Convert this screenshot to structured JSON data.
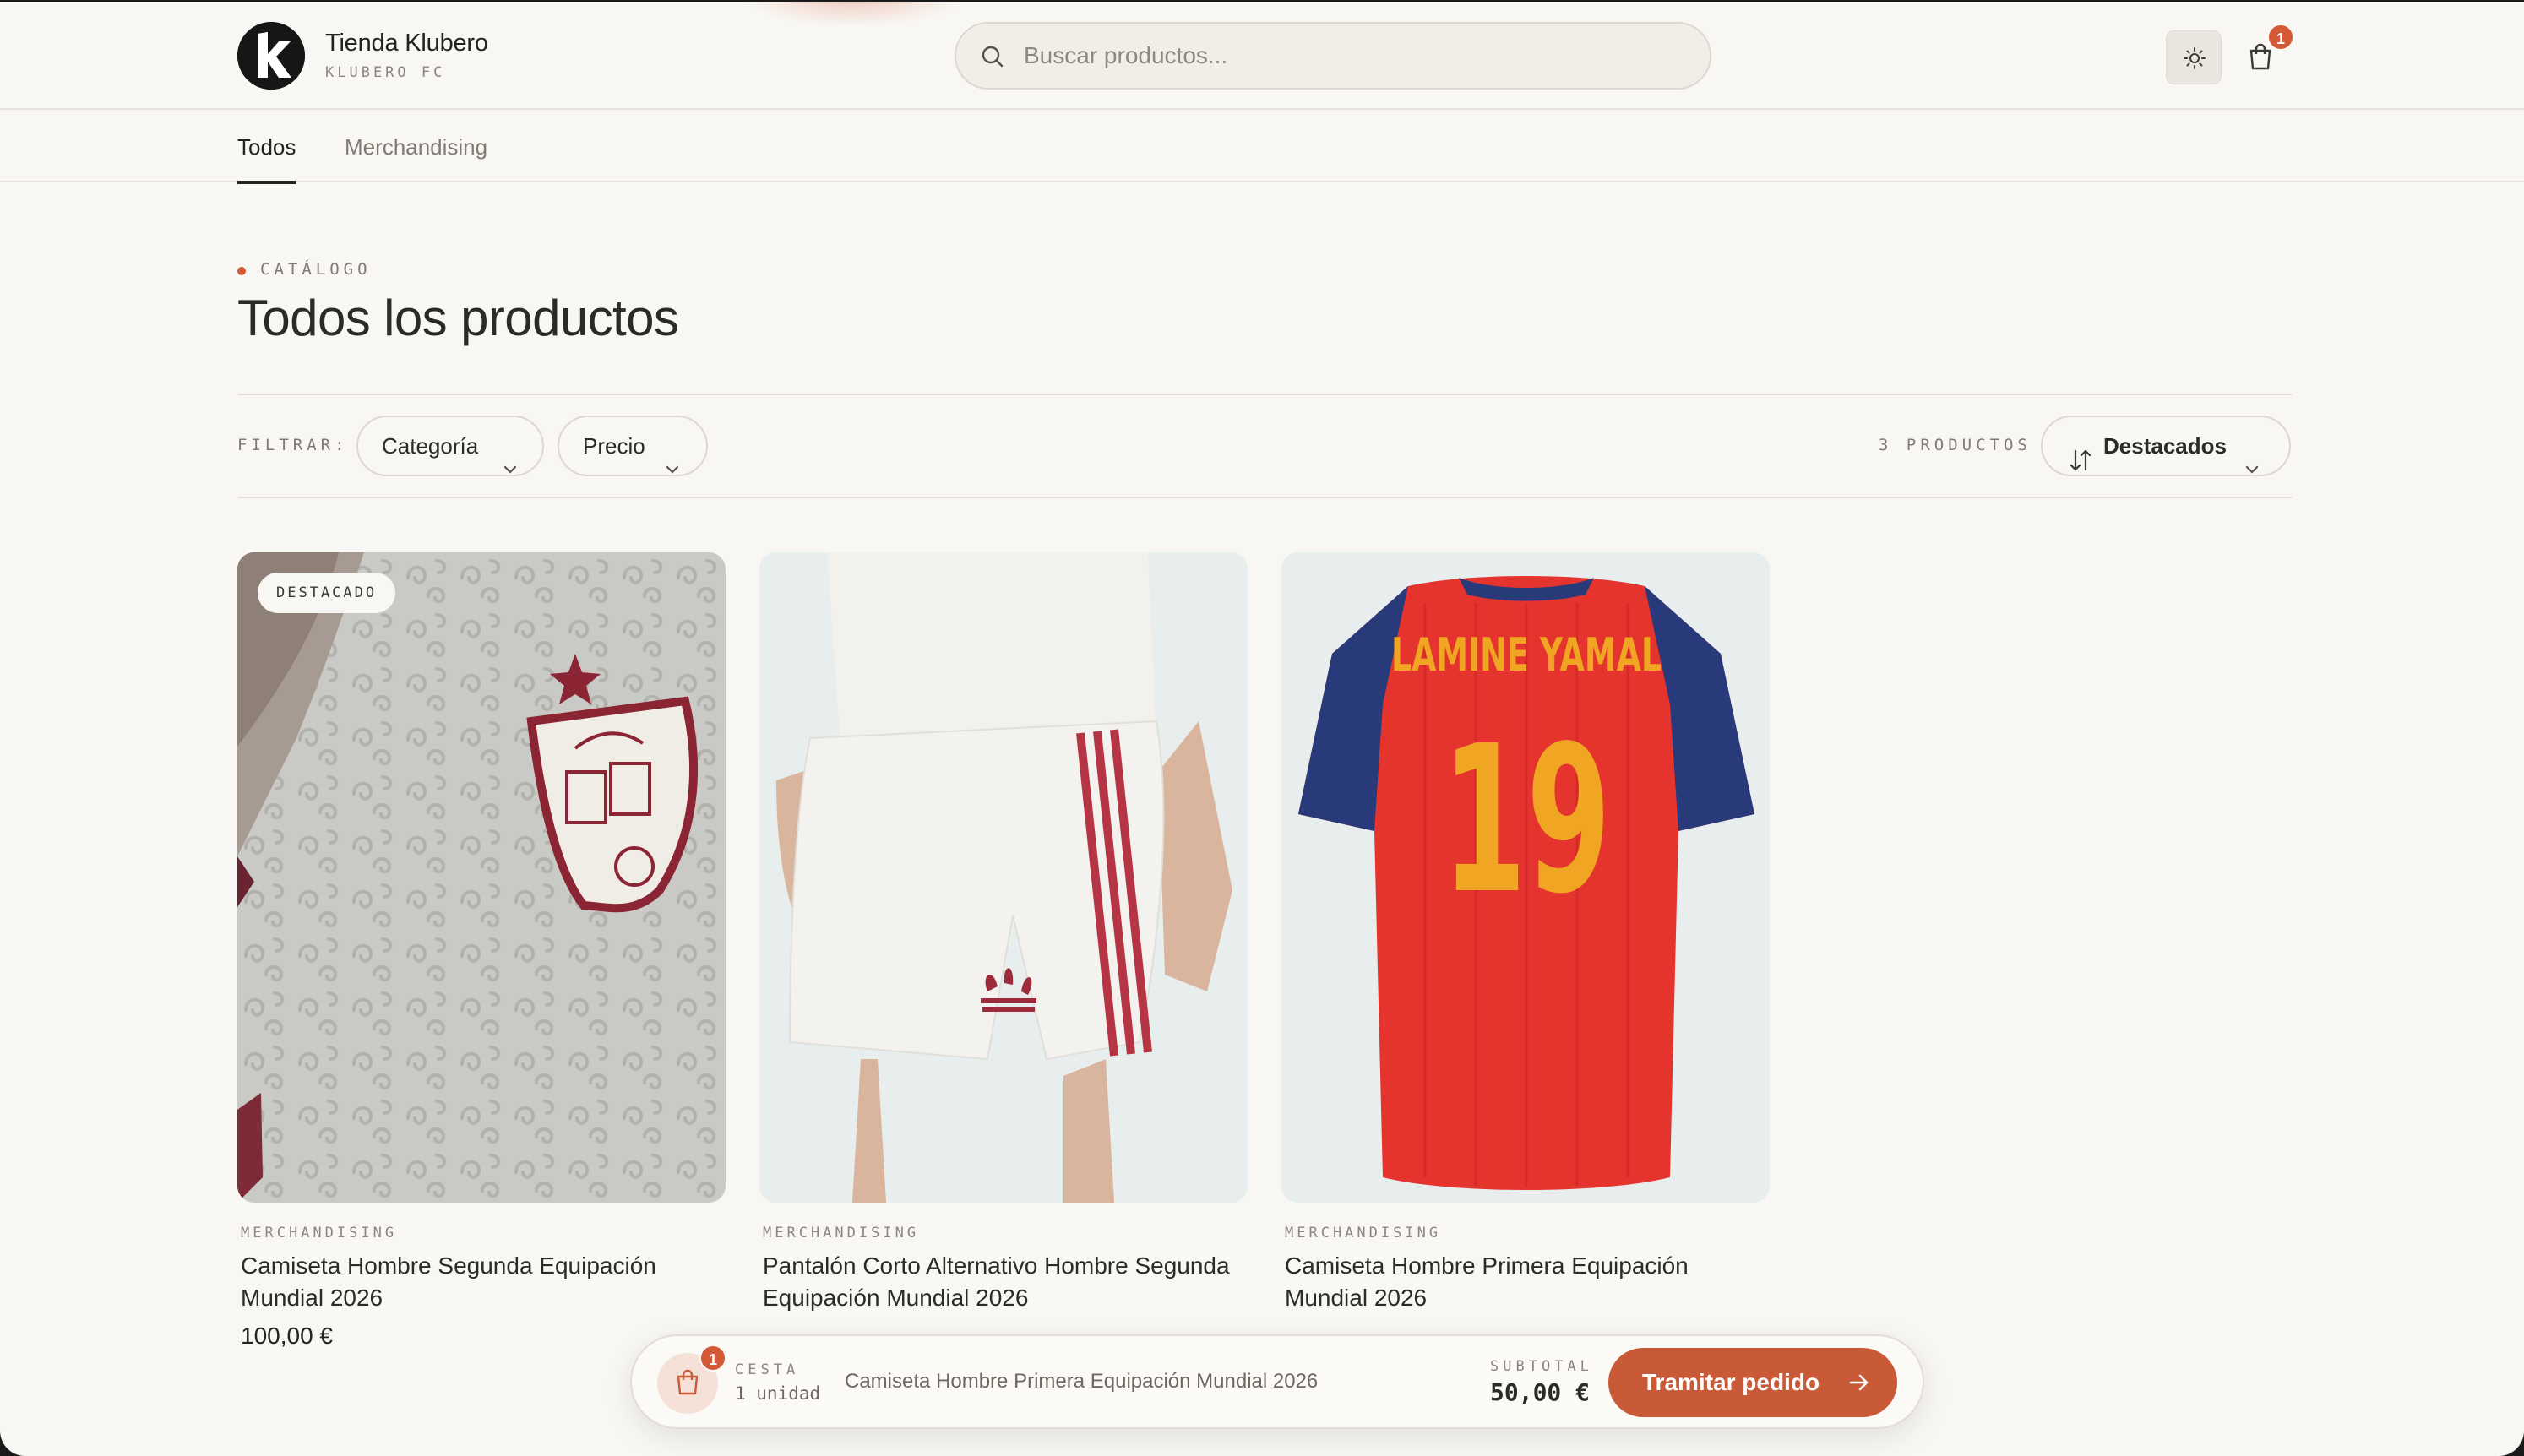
{
  "header": {
    "brand_name": "Tienda Klubero",
    "brand_sub": "KLUBERO FC",
    "search_placeholder": "Buscar productos...",
    "cart_count": "1"
  },
  "tabs": [
    {
      "label": "Todos",
      "active": true
    },
    {
      "label": "Merchandising",
      "active": false
    }
  ],
  "catalog": {
    "eyebrow": "CATÁLOGO",
    "title": "Todos los productos"
  },
  "filters": {
    "label": "FILTRAR:",
    "category": "Categoría",
    "price": "Precio",
    "count": "3 PRODUCTOS",
    "sort": "Destacados"
  },
  "products": [
    {
      "badge": "DESTACADO",
      "category": "MERCHANDISING",
      "name": "Camiseta Hombre Segunda Equipación Mundial 2026",
      "price": "100,00 €"
    },
    {
      "category": "MERCHANDISING",
      "name": "Pantalón Corto Alternativo Hombre Segunda Equipación Mundial 2026",
      "price": ""
    },
    {
      "category": "MERCHANDISING",
      "name": "Camiseta Hombre Primera Equipación Mundial 2026",
      "price": "",
      "jersey_name": "LAMINE YAMAL",
      "jersey_number": "19"
    }
  ],
  "cart_bar": {
    "count": "1",
    "label": "CESTA",
    "units": "1 unidad",
    "item": "Camiseta Hombre Primera Equipación Mundial 2026",
    "subtotal_label": "SUBTOTAL",
    "subtotal_value": "50,00 €",
    "checkout_label": "Tramitar pedido"
  },
  "colors": {
    "accent": "#d45a37",
    "background": "#f8f7f3",
    "text": "#2b2a26"
  }
}
